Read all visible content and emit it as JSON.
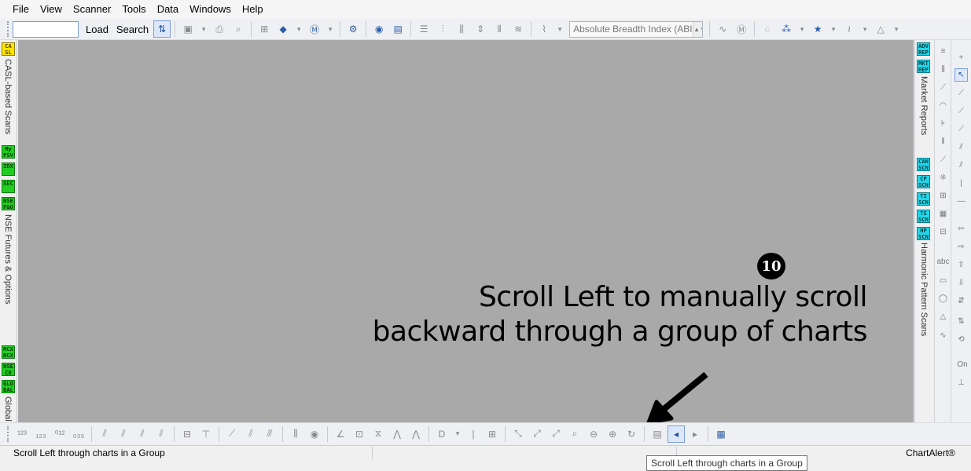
{
  "menu": [
    "File",
    "View",
    "Scanner",
    "Tools",
    "Data",
    "Windows",
    "Help"
  ],
  "toolbar": {
    "search_placeholder": "",
    "load_label": "Load",
    "search_label": "Search",
    "indicator_select": "Absolute Breadth Index (ABI"
  },
  "left_panel": {
    "badges": [
      {
        "label": "CA SL",
        "color": "yellow"
      },
      {
        "label": "My PSV",
        "color": "green"
      },
      {
        "label": "IDX",
        "color": "green"
      },
      {
        "label": "SEC",
        "color": "green"
      },
      {
        "label": "NSE F&O",
        "color": "green"
      },
      {
        "label": "MCX NCX",
        "color": "green"
      },
      {
        "label": "NSE CD",
        "color": "green"
      },
      {
        "label": "GLO BAL",
        "color": "green"
      }
    ],
    "tabs": [
      "CASL-based Scans",
      "NSE Futures & Options",
      "Global I"
    ]
  },
  "right_panel": {
    "badges": [
      {
        "label": "ADV REP",
        "color": "cyan"
      },
      {
        "label": "MKT REP",
        "color": "cyan"
      },
      {
        "label": "CAN SCN",
        "color": "cyan"
      },
      {
        "label": "CP SCN",
        "color": "cyan"
      },
      {
        "label": "TI SCN",
        "color": "cyan"
      },
      {
        "label": "TS SCN",
        "color": "cyan"
      },
      {
        "label": "HP SCN",
        "color": "cyan"
      }
    ],
    "tabs": [
      "Market Reports",
      "Harmonic Pattern Scans"
    ],
    "drawing_on": "On"
  },
  "annotation": {
    "number": "10",
    "line1": "Scroll Left to manually scroll",
    "line2": "backward through a group of charts"
  },
  "status": {
    "text": "Scroll Left through charts in a Group",
    "app": "ChartAlert®"
  },
  "tooltip": "Scroll Left through charts in a Group",
  "colors": {
    "canvas": "#a9a9a9",
    "accent": "#2d5da8"
  }
}
